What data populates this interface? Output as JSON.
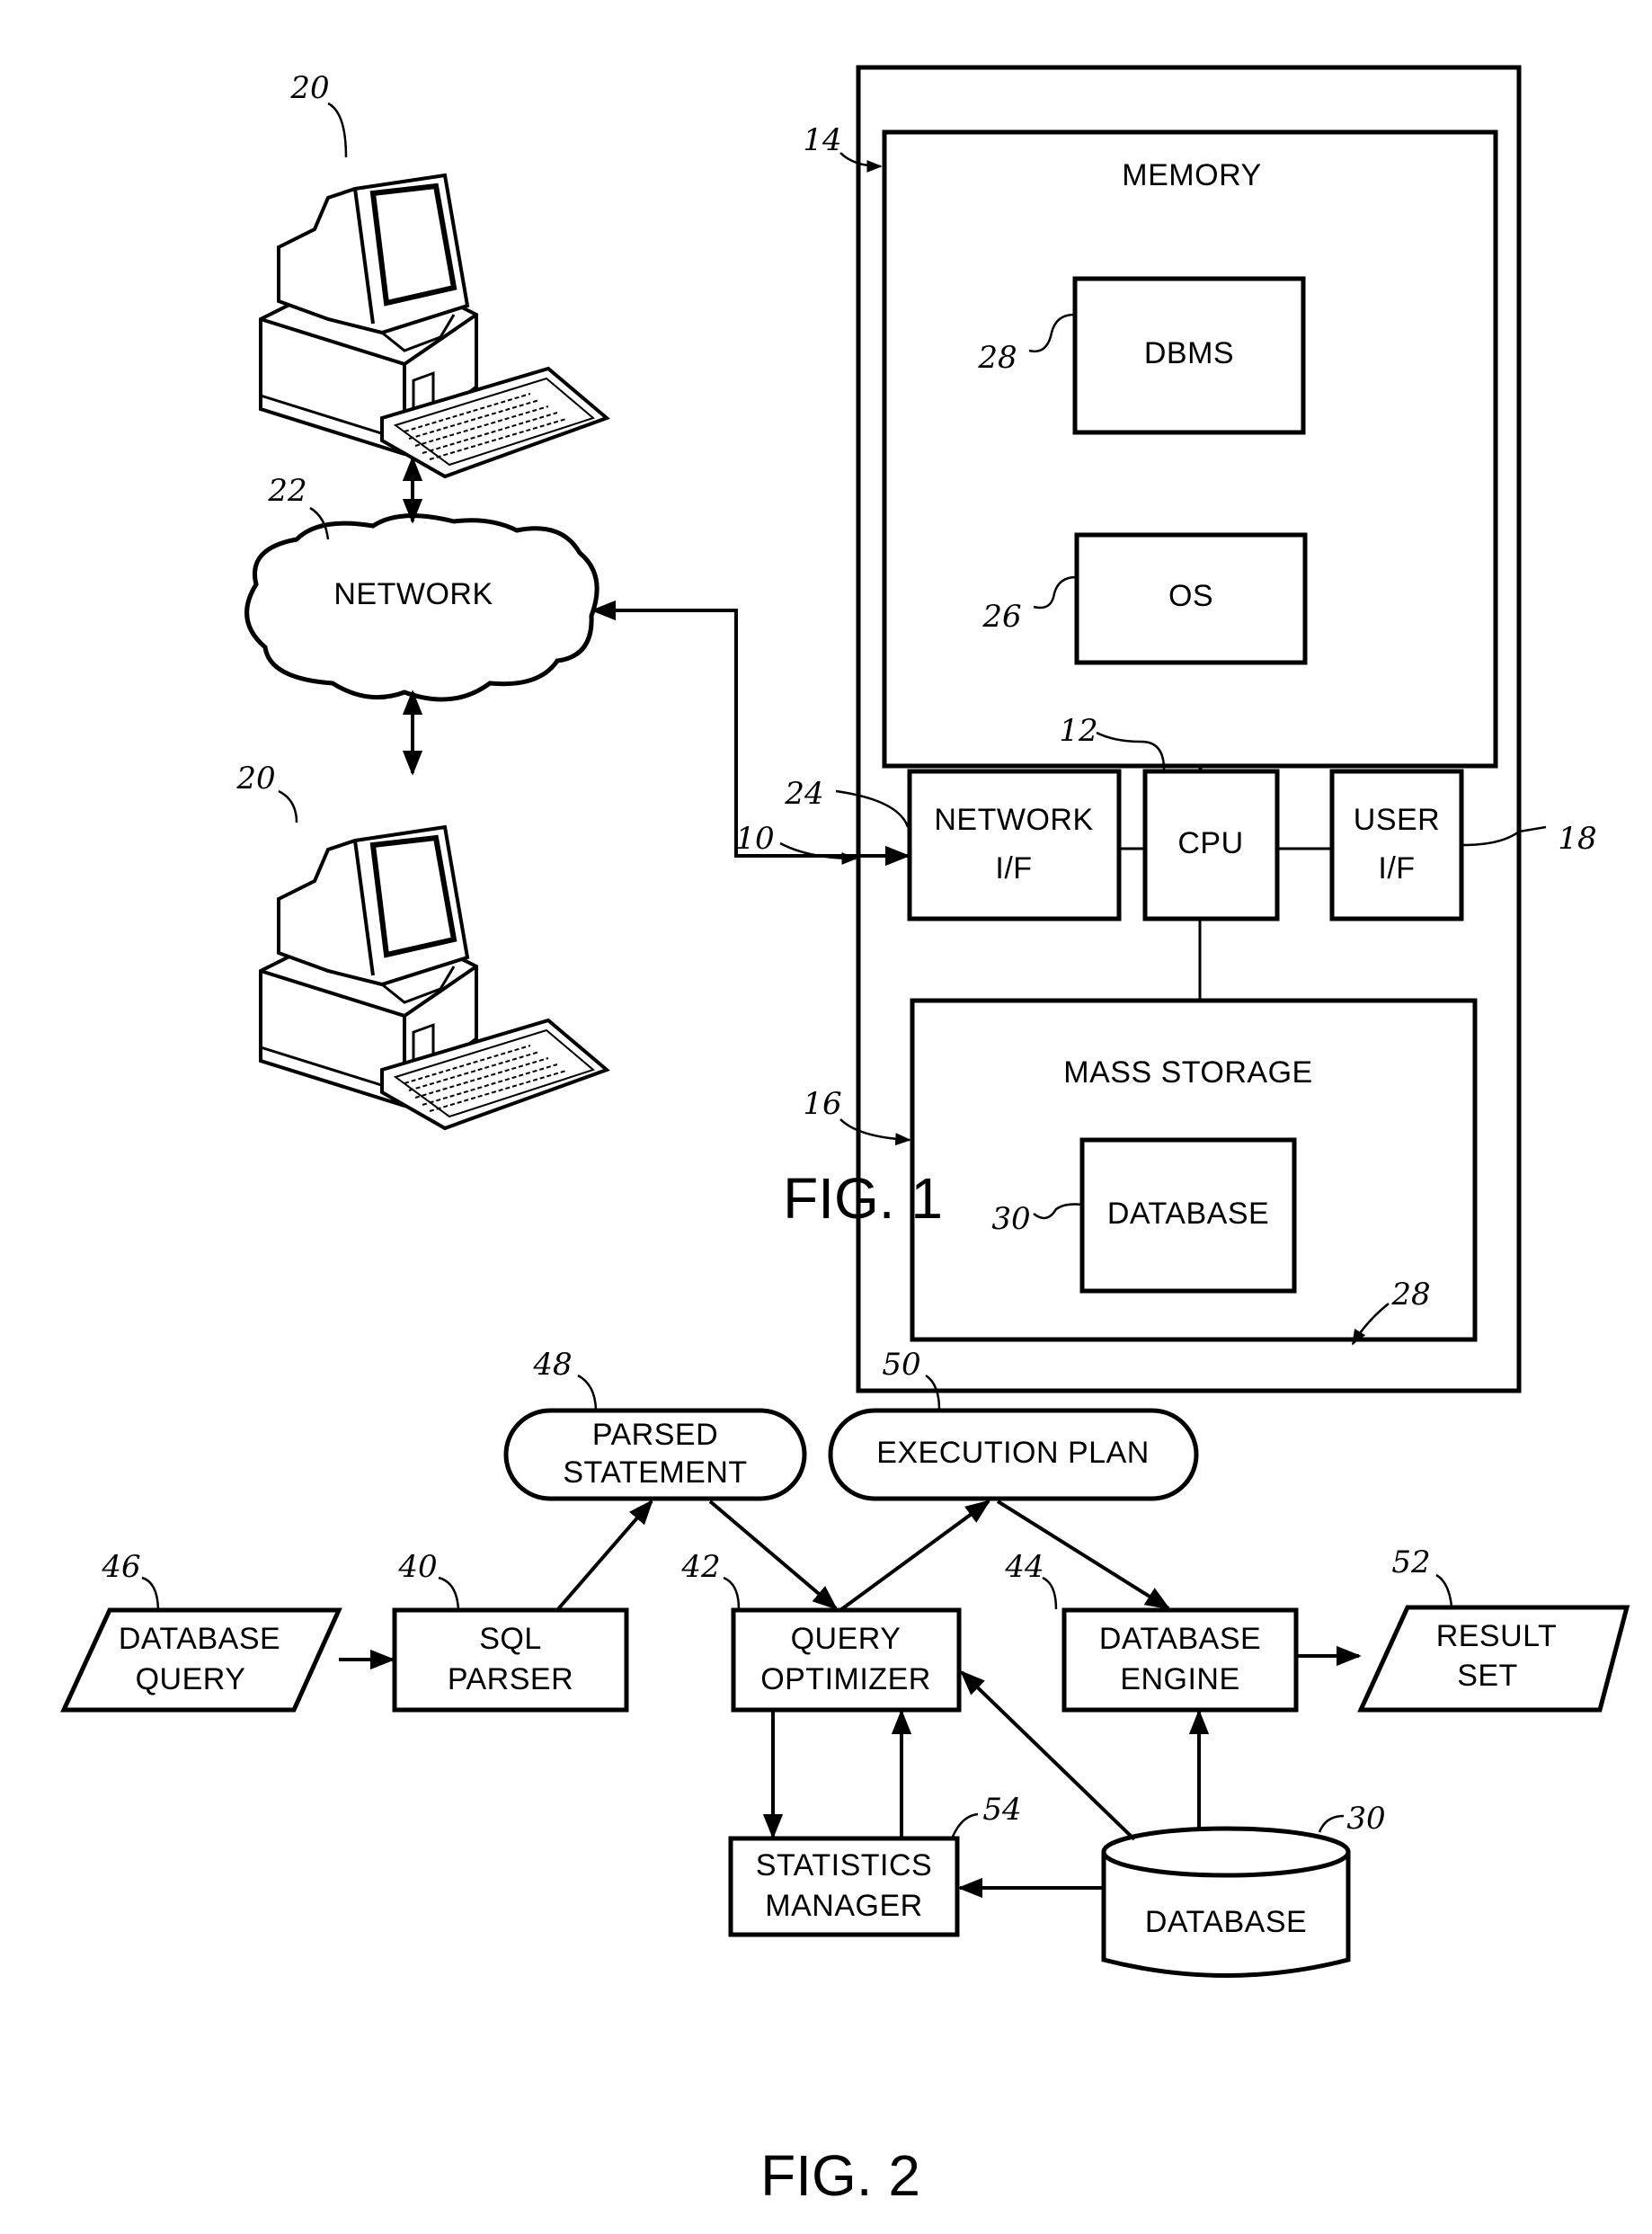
{
  "figure1": {
    "caption": "FIG. 1",
    "computer_system_ref": "10",
    "cpu": {
      "label": "CPU",
      "ref": "12"
    },
    "memory": {
      "label": "MEMORY",
      "ref": "14"
    },
    "mass_storage": {
      "label": "MASS STORAGE",
      "ref": "16"
    },
    "user_interface": {
      "line1": "USER",
      "line2": "I/F",
      "ref": "18"
    },
    "network_interface": {
      "line1": "NETWORK",
      "line2": "I/F",
      "ref": "24"
    },
    "dbms": {
      "label": "DBMS",
      "ref": "28"
    },
    "os": {
      "label": "OS",
      "ref": "26"
    },
    "database": {
      "label": "DATABASE",
      "ref": "30"
    },
    "network": {
      "label": "NETWORK",
      "ref": "22"
    },
    "client_top": {
      "ref": "20",
      "icon": "desktop-computer-icon"
    },
    "client_bottom": {
      "ref": "20",
      "icon": "desktop-computer-icon"
    }
  },
  "figure2": {
    "caption": "FIG. 2",
    "dbms_ref": "28",
    "database_query": {
      "line1": "DATABASE",
      "line2": "QUERY",
      "ref": "46"
    },
    "sql_parser": {
      "line1": "SQL",
      "line2": "PARSER",
      "ref": "40"
    },
    "parsed_statement": {
      "line1": "PARSED",
      "line2": "STATEMENT",
      "ref": "48"
    },
    "execution_plan": {
      "label": "EXECUTION PLAN",
      "ref": "50"
    },
    "query_optimizer": {
      "line1": "QUERY",
      "line2": "OPTIMIZER",
      "ref": "42"
    },
    "database_engine": {
      "line1": "DATABASE",
      "line2": "ENGINE",
      "ref": "44"
    },
    "result_set": {
      "line1": "RESULT",
      "line2": "SET",
      "ref": "52"
    },
    "statistics_manager": {
      "line1": "STATISTICS",
      "line2": "MANAGER",
      "ref": "54"
    },
    "database": {
      "label": "DATABASE",
      "ref": "30"
    }
  }
}
